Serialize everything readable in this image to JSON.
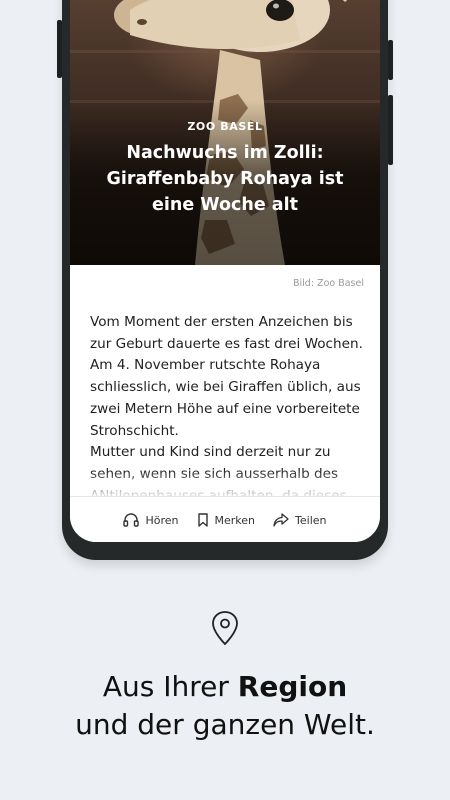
{
  "article": {
    "kicker": "ZOO BASEL",
    "headline": "Nachwuchs im Zolli: Giraffenbaby Rohaya ist eine Woche alt",
    "image_credit": "Bild: Zoo Basel",
    "paragraphs": [
      "Vom Moment der ersten Anzeichen bis zur Geburt dauerte es fast drei Wochen. Am 4. November rutschte Rohaya schliesslich, wie bei Giraffen üblich, aus zwei Metern Höhe auf eine vorbereitete Strohschicht.",
      "Mutter und Kind sind derzeit nur zu sehen, wenn sie sich ausserhalb des ANtilopenhauses aufhalten, da dieses"
    ]
  },
  "actions": {
    "listen": "Hören",
    "bookmark": "Merken",
    "share": "Teilen"
  },
  "promo": {
    "icon": "location-pin-icon",
    "line1_prefix": "Aus Ihrer ",
    "line1_bold": "Region",
    "line2": "und der ganzen Welt."
  },
  "colors": {
    "background": "#eceff3",
    "phone_frame": "#26292a",
    "text": "#111111"
  }
}
